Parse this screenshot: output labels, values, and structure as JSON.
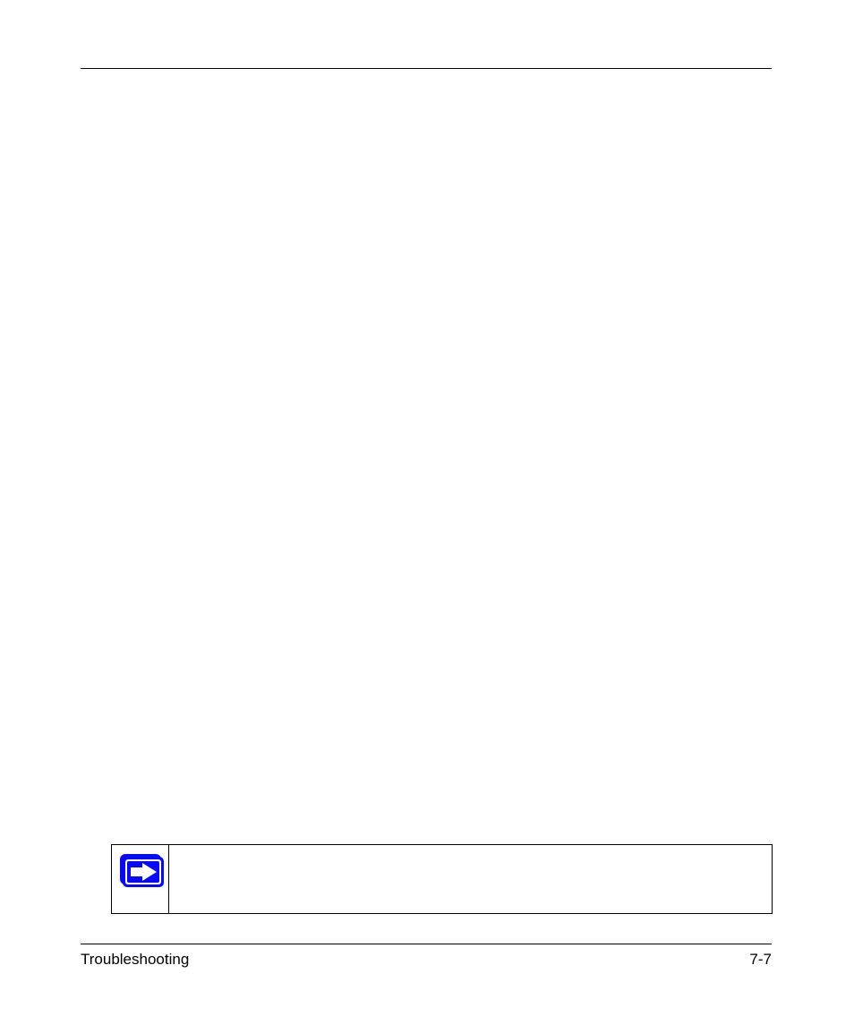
{
  "footer": {
    "section": "Troubleshooting",
    "page_number": "7-7"
  },
  "callout": {
    "icon_name": "arrow-right-note-icon",
    "note_text": ""
  }
}
